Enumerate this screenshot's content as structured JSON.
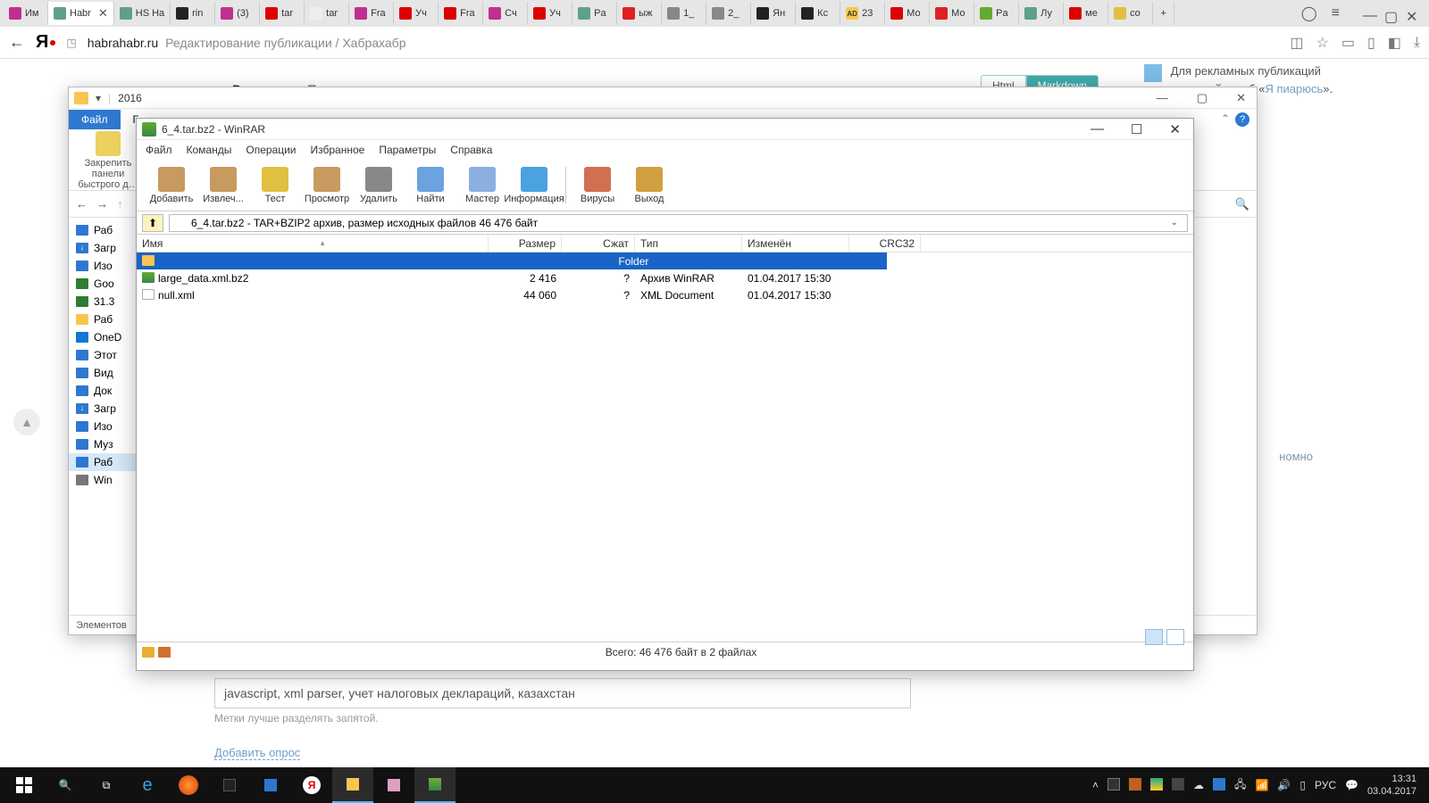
{
  "browser": {
    "tabs": [
      {
        "label": "Им",
        "fav": "#c0308f"
      },
      {
        "label": "Habr",
        "fav": "#5fa08b",
        "active": true,
        "closeable": true
      },
      {
        "label": "HS Ha",
        "fav": "#5fa08b"
      },
      {
        "label": "rin",
        "fav": "#222"
      },
      {
        "label": "(3)",
        "fav": "#c0308f"
      },
      {
        "label": "tar",
        "fav": "#d00"
      },
      {
        "label": "tar",
        "fav": "#eee"
      },
      {
        "label": "Fra",
        "fav": "#c0308f"
      },
      {
        "label": "Уч",
        "fav": "#d00"
      },
      {
        "label": "Fra",
        "fav": "#d00"
      },
      {
        "label": "Сч",
        "fav": "#c0308f"
      },
      {
        "label": "Уч",
        "fav": "#d00"
      },
      {
        "label": "Pa",
        "fav": "#5fa08b"
      },
      {
        "label": "ыж",
        "fav": "#d22"
      },
      {
        "label": "1_",
        "fav": "#888"
      },
      {
        "label": "2_",
        "fav": "#888"
      },
      {
        "label": "Ян",
        "fav": "#222"
      },
      {
        "label": "Кс",
        "fav": "#222"
      },
      {
        "label": "23",
        "fav": "#e0a000",
        "favtext": "AD"
      },
      {
        "label": "Мо",
        "fav": "#d00"
      },
      {
        "label": "Мо",
        "fav": "#d22"
      },
      {
        "label": "Pa",
        "fav": "#6a3"
      },
      {
        "label": "Лу",
        "fav": "#5fa08b"
      },
      {
        "label": "ме",
        "fav": "#d00"
      },
      {
        "label": "co",
        "fav": "#e0c040"
      }
    ],
    "new_tab": "+",
    "address": {
      "host": "habrahabr.ru",
      "path": "Редактирование публикации / Хабрахабр"
    },
    "right_icons": [
      "bookmark",
      "star",
      "panel",
      "device",
      "ext",
      "download"
    ]
  },
  "page": {
    "editor_tabs": [
      "Редактор",
      "Просмотр"
    ],
    "toggle": {
      "a": "Html",
      "b": "Markdown"
    },
    "side": {
      "line1": "Для рекламных публикаций",
      "line2a": "используйте хаб «",
      "link": "Я пиарюсь",
      "line2b": "»."
    },
    "anon_label": "номно",
    "tags_value": "javascript, xml parser, учет налоговых деклараций, казахстан",
    "tags_hint": "Метки лучше разделять запятой.",
    "add_poll": "Добавить опрос"
  },
  "explorer": {
    "title": "2016",
    "tabs": [
      "Файл",
      "Г…"
    ],
    "quick": {
      "title": "Закрепить панели быстрого д…"
    },
    "nav": {
      "back": "←",
      "fwd": "→",
      "up": "↑"
    },
    "tree": [
      {
        "label": "Раб",
        "color": "#2e78d0"
      },
      {
        "label": "Загр",
        "color": "#2e78d0",
        "arrow": "↓"
      },
      {
        "label": "Изо",
        "color": "#2e78d0"
      },
      {
        "label": "Goo",
        "color": "#2e7d32"
      },
      {
        "label": "31.3",
        "color": "#2e7d32"
      },
      {
        "label": "Раб",
        "color": "#f8c550"
      },
      {
        "label": "OneD",
        "color": "#1177d0"
      },
      {
        "label": "Этот",
        "color": "#2e78d0"
      },
      {
        "label": "Вид",
        "color": "#2e78d0"
      },
      {
        "label": "Док",
        "color": "#2e78d0"
      },
      {
        "label": "Загр",
        "color": "#2e78d0",
        "arrow": "↓"
      },
      {
        "label": "Изо",
        "color": "#2e78d0"
      },
      {
        "label": "Муз",
        "color": "#2e78d0"
      },
      {
        "label": "Раб",
        "color": "#2e78d0",
        "sel": true
      },
      {
        "label": "Win",
        "color": "#777"
      }
    ],
    "status": "Элементов"
  },
  "winrar": {
    "title": "6_4.tar.bz2 - WinRAR",
    "menu": [
      "Файл",
      "Команды",
      "Операции",
      "Избранное",
      "Параметры",
      "Справка"
    ],
    "toolbar": [
      {
        "label": "Добавить",
        "color": "#c89a60"
      },
      {
        "label": "Извлеч...",
        "color": "#c89a60"
      },
      {
        "label": "Тест",
        "color": "#e0c040"
      },
      {
        "label": "Просмотр",
        "color": "#c89a60"
      },
      {
        "label": "Удалить",
        "color": "#888"
      },
      {
        "label": "Найти",
        "color": "#6aa3e0"
      },
      {
        "label": "Мастер",
        "color": "#8ab0e0"
      },
      {
        "label": "Информация",
        "color": "#4aa3e0"
      },
      {
        "sep": true
      },
      {
        "label": "Вирусы",
        "color": "#d07050"
      },
      {
        "label": "Выход",
        "color": "#d0a040"
      }
    ],
    "address": "6_4.tar.bz2 - TAR+BZIP2 архив, размер исходных файлов 46 476 байт",
    "columns": [
      "Имя",
      "Размер",
      "Сжат",
      "Тип",
      "Изменён",
      "CRC32"
    ],
    "rows": [
      {
        "name": "..",
        "size": "",
        "packed": "",
        "type": "Folder",
        "modified": "",
        "crc": "",
        "sel": true,
        "icon": "folder"
      },
      {
        "name": "large_data.xml.bz2",
        "size": "2 416",
        "packed": "?",
        "type": "Архив WinRAR",
        "modified": "01.04.2017 15:30",
        "crc": "",
        "icon": "arch"
      },
      {
        "name": "null.xml",
        "size": "44 060",
        "packed": "?",
        "type": "XML Document",
        "modified": "01.04.2017 15:30",
        "crc": "",
        "icon": "xml"
      }
    ],
    "status": "Всего: 46 476 байт в 2 файлах"
  },
  "taskbar": {
    "lang": "РУС",
    "time": "13:31",
    "date": "03.04.2017"
  }
}
